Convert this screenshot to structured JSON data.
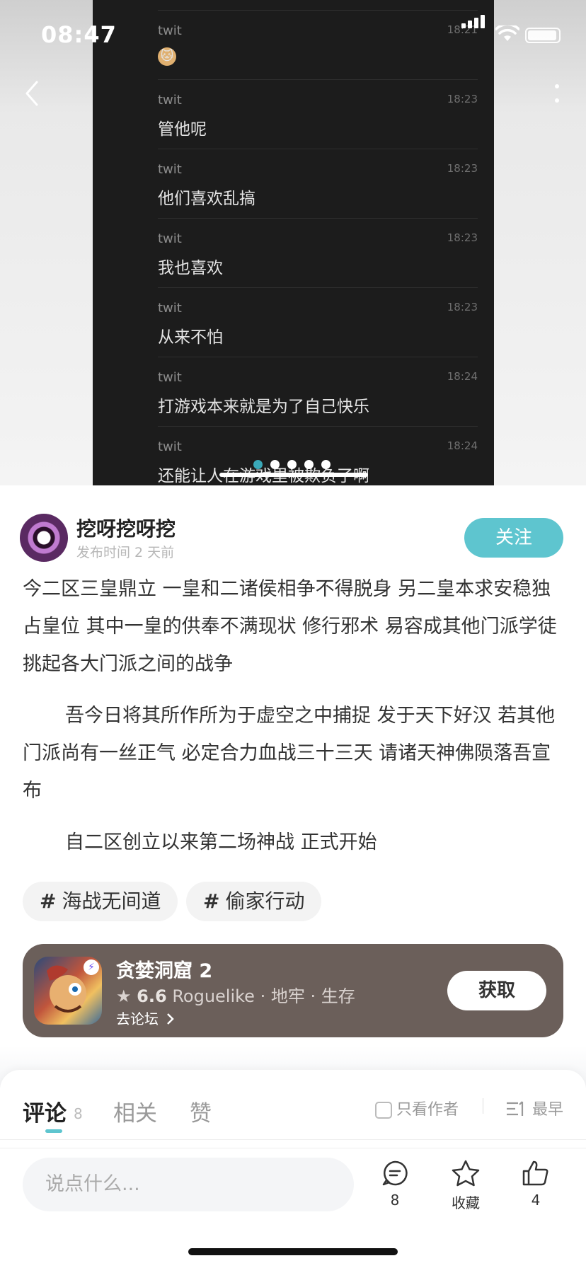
{
  "status_bar": {
    "time": "08:47"
  },
  "chat_screenshot": {
    "messages": [
      {
        "user": "twit",
        "time": "18:21",
        "text": "",
        "emoji": "🐱"
      },
      {
        "user": "twit",
        "time": "18:23",
        "text": "管他呢"
      },
      {
        "user": "twit",
        "time": "18:23",
        "text": "他们喜欢乱搞"
      },
      {
        "user": "twit",
        "time": "18:23",
        "text": "我也喜欢"
      },
      {
        "user": "twit",
        "time": "18:23",
        "text": "从来不怕"
      },
      {
        "user": "twit",
        "time": "18:24",
        "text": "打游戏本来就是为了自己快乐"
      },
      {
        "user": "twit",
        "time": "18:24",
        "text": "还能让人在游戏里被欺负了啊"
      }
    ],
    "pager": {
      "total": 5,
      "active": 1
    }
  },
  "author": {
    "name": "挖呀挖呀挖",
    "post_time": "发布时间 2 天前",
    "follow_label": "关注"
  },
  "post": {
    "paragraphs": [
      "今二区三皇鼎立 一皇和二诸侯相争不得脱身 另二皇本求安稳独占皇位 其中一皇的供奉不满现状 修行邪术 易容成其他门派学徒 挑起各大门派之间的战争",
      "吾今日将其所作所为于虚空之中捕捉 发于天下好汉 若其他门派尚有一丝正气 必定合力血战三十三天 请诸天神佛陨落吾宣布",
      "自二区创立以来第二场神战 正式开始"
    ]
  },
  "tags": [
    {
      "hash": "#",
      "label": "海战无间道"
    },
    {
      "hash": "#",
      "label": "偷家行动"
    }
  ],
  "game_card": {
    "title": "贪婪洞窟 2",
    "score": "6.6",
    "genres": "Roguelike · 地牢 · 生存",
    "forum_label": "去论坛",
    "get_label": "获取"
  },
  "comment_tabs": {
    "tabs": [
      {
        "label": "评论",
        "count": "8",
        "active": true
      },
      {
        "label": "相关",
        "active": false
      },
      {
        "label": "赞",
        "active": false
      }
    ],
    "author_only_label": "只看作者",
    "sort_label": "最早"
  },
  "bottom_bar": {
    "input_placeholder": "说点什么...",
    "comment_count": "8",
    "favorite_label": "收藏",
    "like_count": "4"
  },
  "colors": {
    "accent": "#5ec5cf",
    "game_card_bg": "#6b5f5a",
    "chat_bg": "#1c1c1c"
  }
}
